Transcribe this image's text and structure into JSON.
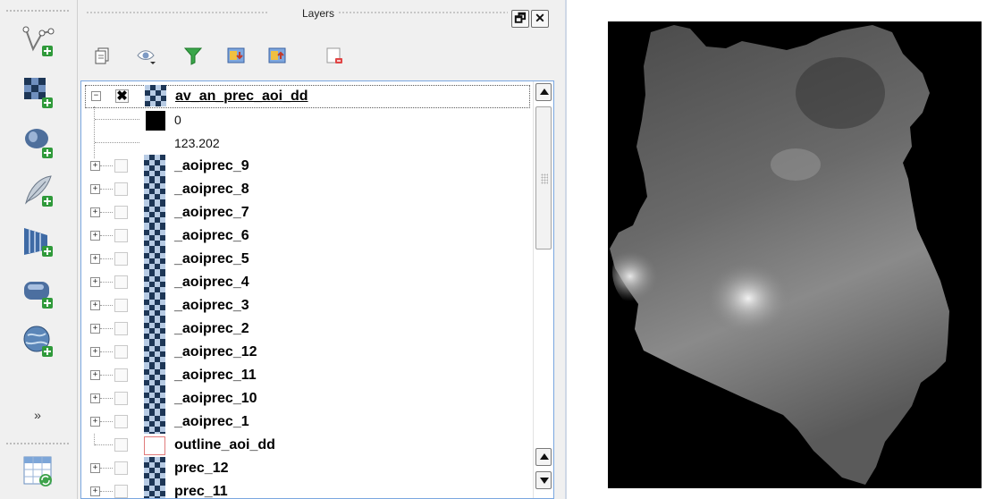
{
  "left_toolbar": {
    "tools": [
      {
        "icon": "add-vector-layer-icon"
      },
      {
        "icon": "add-raster-layer-icon"
      },
      {
        "icon": "add-postgis-layer-icon"
      },
      {
        "icon": "add-spatialite-layer-icon"
      },
      {
        "icon": "add-wms-layer-icon"
      },
      {
        "icon": "add-mssql-layer-icon"
      },
      {
        "icon": "add-wfs-layer-icon"
      }
    ],
    "more_label": "»",
    "bottom_tool": {
      "icon": "add-delimited-text-layer-icon"
    }
  },
  "dock": {
    "title": "Layers",
    "float_button": "🗗",
    "close_button": "✕",
    "toolbar": [
      {
        "icon": "open-layer-styling-icon"
      },
      {
        "icon": "manage-visibility-icon"
      },
      {
        "icon": "filter-legend-icon"
      },
      {
        "icon": "expand-all-icon"
      },
      {
        "icon": "collapse-all-icon"
      },
      {
        "icon": "remove-layer-icon"
      }
    ]
  },
  "layers": {
    "selected": {
      "name": "av_an_prec_aoi_dd",
      "checked_mark": "✖",
      "legend": [
        {
          "label": "0",
          "color": "#000000"
        },
        {
          "label": "123.202"
        }
      ]
    },
    "items": [
      {
        "name": "_aoiprec_9",
        "expander": "+"
      },
      {
        "name": "_aoiprec_8",
        "expander": "+"
      },
      {
        "name": "_aoiprec_7",
        "expander": "+"
      },
      {
        "name": "_aoiprec_6",
        "expander": "+"
      },
      {
        "name": "_aoiprec_5",
        "expander": "+"
      },
      {
        "name": "_aoiprec_4",
        "expander": "+"
      },
      {
        "name": "_aoiprec_3",
        "expander": "+"
      },
      {
        "name": "_aoiprec_2",
        "expander": "+"
      },
      {
        "name": "_aoiprec_12",
        "expander": "+"
      },
      {
        "name": "_aoiprec_11",
        "expander": "+"
      },
      {
        "name": "_aoiprec_10",
        "expander": "+"
      },
      {
        "name": "_aoiprec_1",
        "expander": "+"
      },
      {
        "name": "outline_aoi_dd",
        "expander": ""
      },
      {
        "name": "prec_12",
        "expander": "+"
      },
      {
        "name": "prec_11",
        "expander": "+"
      }
    ]
  },
  "colors": {
    "panel_border": "#7aa7e0",
    "checker_dark": "#1d3656",
    "checker_light": "#b7cbe4",
    "map_background": "#000000"
  }
}
